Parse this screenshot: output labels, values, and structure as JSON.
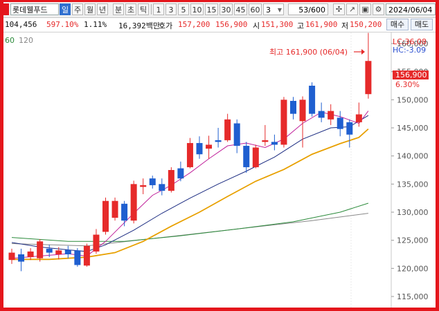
{
  "toolbar": {
    "stock_name": "롯데웰푸드",
    "periods": [
      "일",
      "주",
      "월",
      "년",
      "분",
      "초",
      "틱"
    ],
    "active_period": "일",
    "intervals": [
      "1",
      "3",
      "5",
      "10",
      "15",
      "30",
      "45",
      "60"
    ],
    "interval_value": "3",
    "count_display": "53/600",
    "date_value": "2024/06/04"
  },
  "info": {
    "volume": "104,456",
    "volume_ratio": "597.10%",
    "turnover": "1.11%",
    "amount": "16,392백만",
    "quote_label": "호가",
    "ask": "157,200",
    "bid": "156,900",
    "open_label": "시",
    "open": "151,300",
    "high_label": "고",
    "high": "161,900",
    "low_label": "저",
    "low": "150,200",
    "buy_label": "매수",
    "sell_label": "매도"
  },
  "chart_legend": {
    "ma_a": "60",
    "ma_b": "120"
  },
  "chart_data": {
    "type": "candlestick",
    "y_ticks": [
      "160,000",
      "155,000",
      "150,000",
      "145,000",
      "140,000",
      "135,000",
      "130,000",
      "125,000",
      "120,000",
      "115,000"
    ],
    "ylim": [
      114000,
      164000
    ],
    "high_annotation": "최고 161,900 (06/04)",
    "lc_label": "LC:36.08",
    "hc_label": "HC:-3.09",
    "current_price": "156,900",
    "change_pct": "6.30%",
    "colors": {
      "up": "#e62a2a",
      "down": "#1f5fd0",
      "ma5": "#c0209a",
      "ma20": "#1a2a80",
      "ma60": "#e8a000",
      "ma120": "#2a8a3a",
      "ma240": "#888888"
    },
    "candles": [
      {
        "o": 121500,
        "c": 122800,
        "h": 123500,
        "l": 120800
      },
      {
        "o": 122500,
        "c": 121200,
        "h": 123500,
        "l": 119500
      },
      {
        "o": 122000,
        "c": 123000,
        "h": 123600,
        "l": 121500
      },
      {
        "o": 121800,
        "c": 124800,
        "h": 125200,
        "l": 121200
      },
      {
        "o": 123500,
        "c": 122800,
        "h": 124200,
        "l": 122000
      },
      {
        "o": 122500,
        "c": 123200,
        "h": 123800,
        "l": 121600
      },
      {
        "o": 123300,
        "c": 122500,
        "h": 124000,
        "l": 121800
      },
      {
        "o": 123200,
        "c": 120600,
        "h": 123600,
        "l": 120300
      },
      {
        "o": 120500,
        "c": 124000,
        "h": 124400,
        "l": 120300
      },
      {
        "o": 123000,
        "c": 126000,
        "h": 127000,
        "l": 122600
      },
      {
        "o": 126500,
        "c": 132000,
        "h": 132600,
        "l": 126000
      },
      {
        "o": 129000,
        "c": 132000,
        "h": 132600,
        "l": 128500
      },
      {
        "o": 131500,
        "c": 128500,
        "h": 132000,
        "l": 127500
      },
      {
        "o": 128500,
        "c": 135000,
        "h": 135600,
        "l": 128000
      },
      {
        "o": 134500,
        "c": 134800,
        "h": 136000,
        "l": 133200
      },
      {
        "o": 136000,
        "c": 134800,
        "h": 136500,
        "l": 134200
      },
      {
        "o": 135000,
        "c": 133800,
        "h": 136000,
        "l": 133000
      },
      {
        "o": 133800,
        "c": 137500,
        "h": 138000,
        "l": 133500
      },
      {
        "o": 137800,
        "c": 136000,
        "h": 139000,
        "l": 135500
      },
      {
        "o": 138000,
        "c": 142300,
        "h": 143200,
        "l": 137800
      },
      {
        "o": 142300,
        "c": 140300,
        "h": 143500,
        "l": 139500
      },
      {
        "o": 141300,
        "c": 142000,
        "h": 143600,
        "l": 139500
      },
      {
        "o": 142800,
        "c": 142500,
        "h": 145000,
        "l": 141500
      },
      {
        "o": 142800,
        "c": 146500,
        "h": 147500,
        "l": 142500
      },
      {
        "o": 145800,
        "c": 141800,
        "h": 146500,
        "l": 140500
      },
      {
        "o": 141800,
        "c": 138000,
        "h": 142500,
        "l": 137000
      },
      {
        "o": 138000,
        "c": 141500,
        "h": 142000,
        "l": 137800
      },
      {
        "o": 142500,
        "c": 142800,
        "h": 145500,
        "l": 141800
      },
      {
        "o": 142500,
        "c": 142000,
        "h": 143800,
        "l": 141000
      },
      {
        "o": 142000,
        "c": 150000,
        "h": 150500,
        "l": 141500
      },
      {
        "o": 149800,
        "c": 147500,
        "h": 150500,
        "l": 146500
      },
      {
        "o": 146200,
        "c": 150000,
        "h": 150600,
        "l": 141500
      },
      {
        "o": 152500,
        "c": 147500,
        "h": 153100,
        "l": 147000
      },
      {
        "o": 148000,
        "c": 146800,
        "h": 149500,
        "l": 146000
      },
      {
        "o": 146500,
        "c": 148000,
        "h": 149200,
        "l": 145500
      },
      {
        "o": 146800,
        "c": 144800,
        "h": 148000,
        "l": 143500
      },
      {
        "o": 146000,
        "c": 143800,
        "h": 146500,
        "l": 141500
      },
      {
        "o": 146000,
        "c": 147400,
        "h": 149500,
        "l": 145200
      },
      {
        "o": 151000,
        "c": 156900,
        "h": 161900,
        "l": 150200
      }
    ],
    "ma5": [
      {
        "x": 0,
        "y": 121800
      },
      {
        "x": 6,
        "y": 122600
      },
      {
        "x": 8,
        "y": 122200
      },
      {
        "x": 10,
        "y": 124800
      },
      {
        "x": 13,
        "y": 129800
      },
      {
        "x": 15,
        "y": 133000
      },
      {
        "x": 17,
        "y": 134800
      },
      {
        "x": 19,
        "y": 137000
      },
      {
        "x": 21,
        "y": 139500
      },
      {
        "x": 23,
        "y": 141800
      },
      {
        "x": 25,
        "y": 142300
      },
      {
        "x": 27,
        "y": 141500
      },
      {
        "x": 29,
        "y": 143000
      },
      {
        "x": 31,
        "y": 145800
      },
      {
        "x": 33,
        "y": 147800
      },
      {
        "x": 35,
        "y": 147000
      },
      {
        "x": 37,
        "y": 145800
      },
      {
        "x": 38,
        "y": 148000
      }
    ],
    "ma20": [
      {
        "x": 0,
        "y": 124600
      },
      {
        "x": 3,
        "y": 123800
      },
      {
        "x": 6,
        "y": 123300
      },
      {
        "x": 8,
        "y": 123000
      },
      {
        "x": 10,
        "y": 124200
      },
      {
        "x": 13,
        "y": 126800
      },
      {
        "x": 16,
        "y": 129800
      },
      {
        "x": 19,
        "y": 132500
      },
      {
        "x": 22,
        "y": 135000
      },
      {
        "x": 25,
        "y": 137300
      },
      {
        "x": 28,
        "y": 139800
      },
      {
        "x": 31,
        "y": 143000
      },
      {
        "x": 34,
        "y": 145000
      },
      {
        "x": 36,
        "y": 145200
      },
      {
        "x": 38,
        "y": 147200
      }
    ],
    "ma60": [
      {
        "x": 0,
        "y": 121600
      },
      {
        "x": 4,
        "y": 121600
      },
      {
        "x": 8,
        "y": 122000
      },
      {
        "x": 11,
        "y": 122800
      },
      {
        "x": 14,
        "y": 124800
      },
      {
        "x": 17,
        "y": 127500
      },
      {
        "x": 20,
        "y": 130000
      },
      {
        "x": 23,
        "y": 132800
      },
      {
        "x": 26,
        "y": 135500
      },
      {
        "x": 29,
        "y": 137600
      },
      {
        "x": 32,
        "y": 140300
      },
      {
        "x": 35,
        "y": 142200
      },
      {
        "x": 37,
        "y": 143300
      },
      {
        "x": 38,
        "y": 144800
      }
    ],
    "ma120": [
      {
        "x": 0,
        "y": 125500
      },
      {
        "x": 6,
        "y": 124800
      },
      {
        "x": 12,
        "y": 124800
      },
      {
        "x": 18,
        "y": 125800
      },
      {
        "x": 24,
        "y": 127000
      },
      {
        "x": 30,
        "y": 128300
      },
      {
        "x": 35,
        "y": 130000
      },
      {
        "x": 38,
        "y": 131600
      }
    ],
    "ma240": [
      {
        "x": 0,
        "y": 124400
      },
      {
        "x": 8,
        "y": 124000
      },
      {
        "x": 16,
        "y": 125500
      },
      {
        "x": 24,
        "y": 127000
      },
      {
        "x": 32,
        "y": 128500
      },
      {
        "x": 38,
        "y": 129800
      }
    ]
  }
}
